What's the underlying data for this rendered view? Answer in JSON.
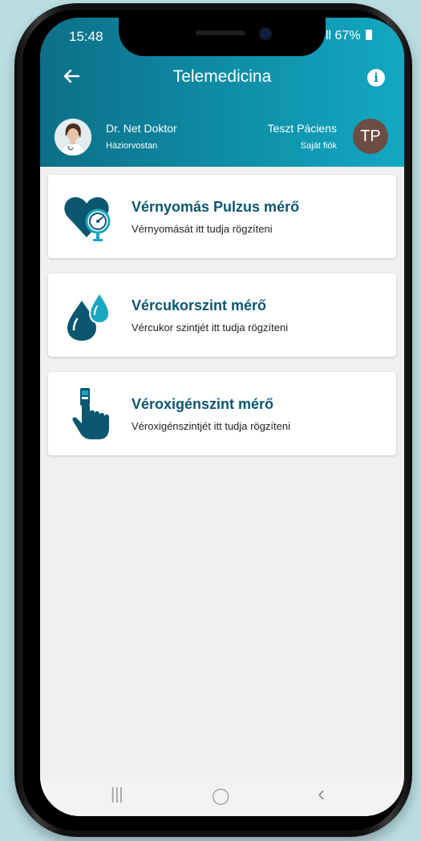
{
  "status": {
    "time": "15:48",
    "signal": "ıll",
    "battery": "67%"
  },
  "header": {
    "title": "Telemedicina",
    "back_icon": "arrow-left-icon",
    "info_icon": "info-icon",
    "info_glyph": "i"
  },
  "doctor": {
    "name": "Dr. Net Doktor",
    "role": "Háziorvostan"
  },
  "patient": {
    "name": "Teszt Páciens",
    "account": "Saját fiók",
    "initials": "TP"
  },
  "cards": [
    {
      "title": "Vérnyomás Pulzus mérő",
      "subtitle": "Vérnyomását itt tudja rögzíteni",
      "icon": "heart-gauge-icon"
    },
    {
      "title": "Vércukorszint mérő",
      "subtitle": "Vércukor szintjét itt tudja rögzíteni",
      "icon": "blood-drop-icon"
    },
    {
      "title": "Véroxigénszint mérő",
      "subtitle": "Véroxigénszintjét itt tudja rögzíteni",
      "icon": "pulse-oximeter-icon"
    }
  ],
  "nav": {
    "recents": "|||",
    "home": "◯",
    "back": "‹"
  },
  "colors": {
    "header_start": "#0d6f88",
    "header_end": "#12a8c2",
    "icon": "#0b5770",
    "accent": "#1aa7c2"
  }
}
